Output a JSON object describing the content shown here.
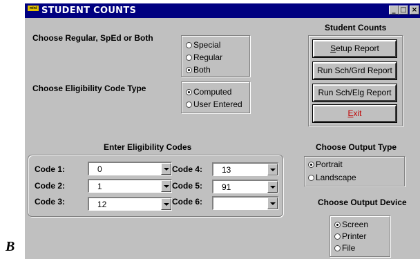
{
  "window": {
    "title": "STUDENT COUNTS",
    "icon_text": "mini"
  },
  "figure_label": "B",
  "program_group": {
    "label": "Choose Regular, SpEd or Both",
    "options": [
      "Special",
      "Regular",
      "Both"
    ],
    "selected": "Both"
  },
  "elig_type_group": {
    "label": "Choose Eligibility Code Type",
    "options": [
      "Computed",
      "User Entered"
    ],
    "selected": "Computed"
  },
  "student_counts": {
    "title": "Student Counts",
    "setup_label": "Setup Report",
    "run_grd_label": "Run Sch/Grd Report",
    "run_elg_label": "Run Sch/Elg Report",
    "exit_label": "Exit"
  },
  "codes": {
    "title": "Enter Eligibility Codes",
    "items": [
      {
        "label": "Code 1:",
        "value": "0"
      },
      {
        "label": "Code 2:",
        "value": "1"
      },
      {
        "label": "Code 3:",
        "value": "12"
      },
      {
        "label": "Code 4:",
        "value": "13"
      },
      {
        "label": "Code 5:",
        "value": "91"
      },
      {
        "label": "Code 6:",
        "value": ""
      }
    ]
  },
  "output_type": {
    "label": "Choose Output Type",
    "options": [
      "Portrait",
      "Landscape"
    ],
    "selected": "Portrait"
  },
  "output_device": {
    "label": "Choose Output Device",
    "options": [
      "Screen",
      "Printer",
      "File"
    ],
    "selected": "Screen"
  }
}
